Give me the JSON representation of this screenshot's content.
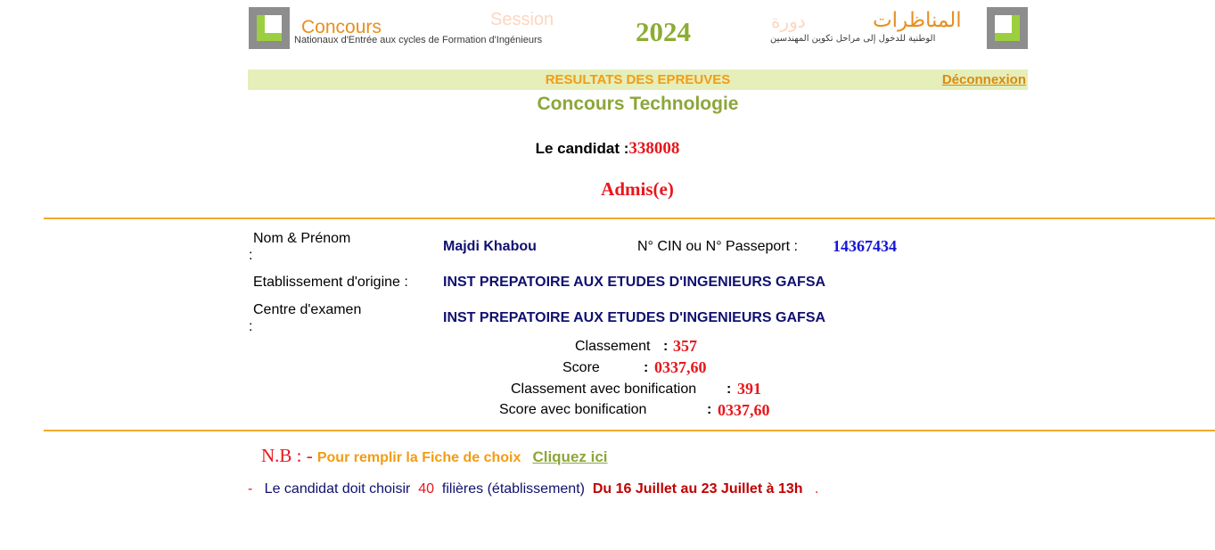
{
  "banner": {
    "concours_word": "Concours",
    "concours_subtitle": "Nationaux d'Entrée aux cycles de Formation d'Ingénieurs",
    "session_word": "Session",
    "year": "2024",
    "arabic_session_word": "دورة",
    "arabic_title": "المناظرات",
    "arabic_subtitle": "الوطنية للدخول إلى مراحل تكوين المهندسين"
  },
  "header": {
    "title": "RESULTATS DES EPREUVES",
    "logout_label": "Déconnexion"
  },
  "subtitle": "Concours Technologie",
  "candidate": {
    "label": "Le candidat :",
    "number": "338008",
    "status": "Admis(e)"
  },
  "details": {
    "name_label": "Nom & Prénom",
    "name_colon": ":",
    "name_value": "Majdi Khabou",
    "cin_label": "N° CIN ou N° Passeport :",
    "cin_value": "14367434",
    "origin_label": "Etablissement d'origine :",
    "origin_value": "INST PREPATOIRE AUX ETUDES D'INGENIEURS GAFSA",
    "center_label": "Centre d'examen",
    "center_colon": ":",
    "center_value": "INST PREPATOIRE AUX ETUDES D'INGENIEURS GAFSA"
  },
  "results": {
    "rank_label": "Classement",
    "rank_value": "357",
    "score_label": "Score",
    "score_value": "0337,60",
    "rank_bonus_label": "Classement avec bonification",
    "rank_bonus_value": "391",
    "score_bonus_label": "Score avec bonification",
    "score_bonus_value": "0337,60",
    "colon": ":"
  },
  "nb": {
    "prefix": "N.B : -",
    "text": "Pour remplir la Fiche de choix",
    "link": "Cliquez ici"
  },
  "note": {
    "dash": "-",
    "text1": "Le candidat doit  choisir",
    "count": "40",
    "text2": "filières (établissement)",
    "dates": "Du 16 Juillet au 23 Juillet à 13h",
    "end": "."
  },
  "colors": {
    "accent_orange": "#f39c12",
    "accent_green": "#8ca63a",
    "red": "#e8161c",
    "navy": "#101070",
    "strip_bg": "#e6eeba",
    "rule": "#f0a830"
  }
}
